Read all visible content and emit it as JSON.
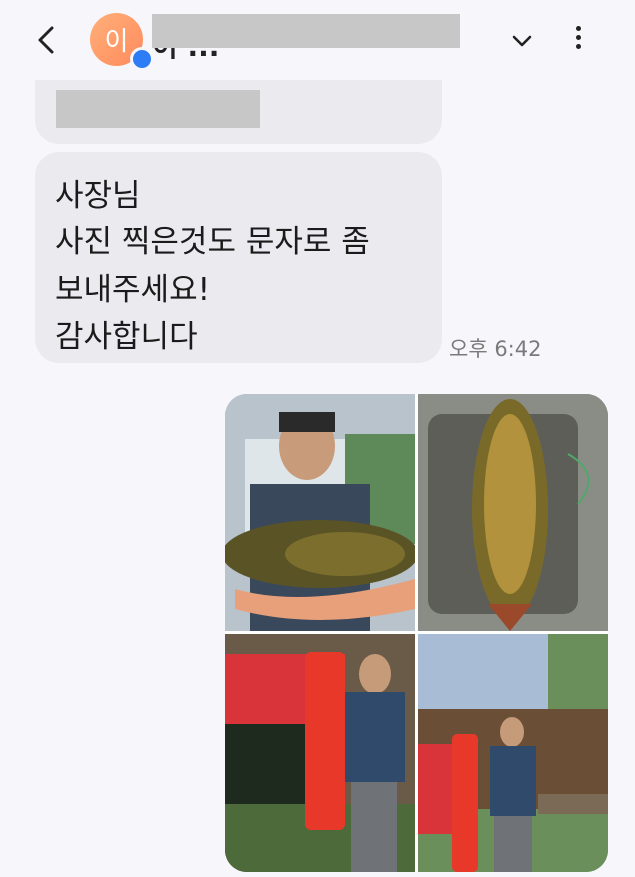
{
  "header": {
    "avatar_initial": "이",
    "contact_name": "이 ...",
    "icons": {
      "back": "back-arrow-icon",
      "expand": "chevron-down-icon",
      "more": "more-vertical-icon"
    }
  },
  "messages": [
    {
      "direction": "incoming",
      "lines": [
        "사장님",
        "사진 찍은것도 문자로 좀",
        "보내주세요!",
        "감사합니다"
      ],
      "time": "오후 6:42"
    },
    {
      "direction": "outgoing",
      "type": "photo-grid",
      "photo_count": 4,
      "photos": [
        {
          "name": "photo-man-holding-carp"
        },
        {
          "name": "photo-carp-on-mat"
        },
        {
          "name": "photo-man-with-prize-banner"
        },
        {
          "name": "photo-man-at-fishing-spot-sign"
        }
      ]
    }
  ],
  "colors": {
    "background": "#f7f7fb",
    "incoming_bubble": "#ebebef",
    "avatar": "#ff9966",
    "badge": "#2f7df6"
  }
}
